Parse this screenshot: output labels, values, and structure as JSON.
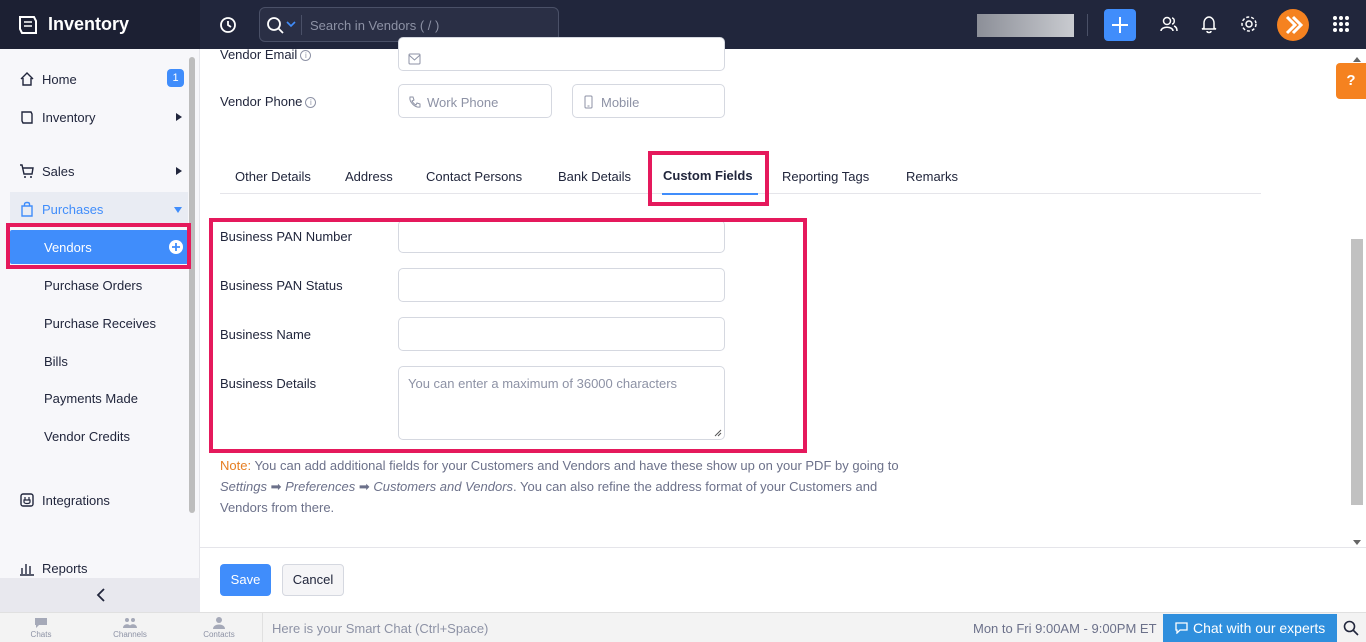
{
  "app": {
    "title": "Inventory"
  },
  "topbar": {
    "search_placeholder": "Search in Vendors ( / )",
    "icons": [
      "history-icon",
      "search-icon",
      "chevron-down-icon",
      "plus-icon",
      "users-icon",
      "bell-icon",
      "gear-icon",
      "avatar",
      "apps-grid-icon"
    ]
  },
  "sidebar": {
    "home": "Home",
    "home_badge": "1",
    "inventory": "Inventory",
    "sales": "Sales",
    "purchases": "Purchases",
    "purchases_sub": [
      "Vendors",
      "Purchase Orders",
      "Purchase Receives",
      "Bills",
      "Payments Made",
      "Vendor Credits"
    ],
    "integrations": "Integrations",
    "reports": "Reports"
  },
  "form": {
    "vendor_email_label": "Vendor Email",
    "vendor_phone_label": "Vendor Phone",
    "work_phone_placeholder": "Work Phone",
    "mobile_placeholder": "Mobile",
    "tabs": [
      "Other Details",
      "Address",
      "Contact Persons",
      "Bank Details",
      "Custom Fields",
      "Reporting Tags",
      "Remarks"
    ],
    "active_tab": "Custom Fields",
    "custom_fields": {
      "pan_number_label": "Business PAN Number",
      "pan_status_label": "Business PAN Status",
      "business_name_label": "Business Name",
      "business_details_label": "Business Details",
      "business_details_placeholder": "You can enter a maximum of 36000 characters"
    },
    "note": {
      "prefix": "Note:",
      "text1": " You can add additional fields for your Customers and Vendors and have these show up on your PDF by going to ",
      "settings": "Settings",
      "arrow": " ➡ ",
      "preferences": "Preferences",
      "arrow2": " ➡ ",
      "customers_vendors": "Customers and Vendors",
      "text2": ". You can also refine the address format of your Customers and Vendors from there."
    },
    "save_label": "Save",
    "cancel_label": "Cancel"
  },
  "help_label": "?",
  "bottombar": {
    "chats": "Chats",
    "channels": "Channels",
    "contacts": "Contacts",
    "smartchat_placeholder": "Here is your Smart Chat (Ctrl+Space)",
    "hours": "Mon to Fri 9:00AM - 9:00PM ET",
    "chat_button": "Chat with our experts"
  },
  "colors": {
    "accent": "#408dfb",
    "highlight": "#e5195c",
    "topbar": "#21263c",
    "brand_orange": "#f58220"
  }
}
